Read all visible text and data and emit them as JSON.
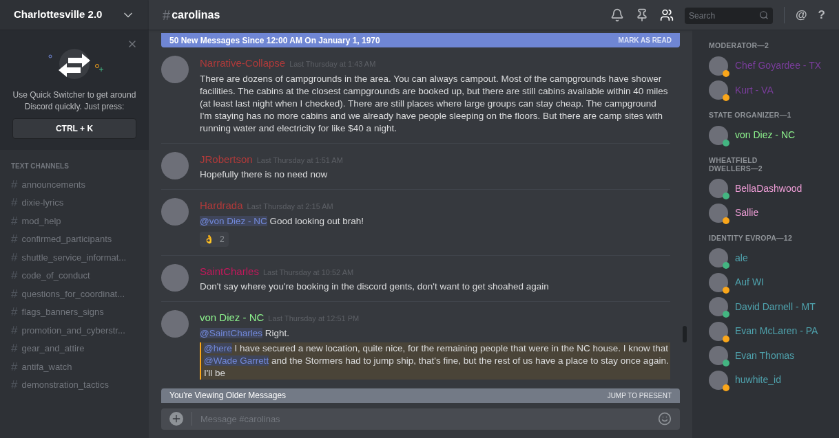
{
  "server": {
    "name": "Charlottesville 2.0"
  },
  "quick_switcher": {
    "text": "Use Quick Switcher to get around Discord quickly. Just press:",
    "shortcut": "CTRL + K"
  },
  "channel_section": {
    "label": "TEXT CHANNELS"
  },
  "channels": [
    {
      "name": "announcements"
    },
    {
      "name": "dixie-lyrics"
    },
    {
      "name": "mod_help"
    },
    {
      "name": "confirmed_participants"
    },
    {
      "name": "shuttle_service_informat..."
    },
    {
      "name": "code_of_conduct"
    },
    {
      "name": "questions_for_coordinat..."
    },
    {
      "name": "flags_banners_signs"
    },
    {
      "name": "promotion_and_cyberstr..."
    },
    {
      "name": "gear_and_attire"
    },
    {
      "name": "antifa_watch"
    },
    {
      "name": "demonstration_tactics"
    }
  ],
  "channel_header": {
    "hash": "#",
    "name": "carolinas"
  },
  "toolbar": {
    "search_placeholder": "Search",
    "glyphs": [
      "@",
      "?"
    ]
  },
  "new_messages_bar": {
    "text": "50 New Messages Since 12:00 AM On January 1, 1970",
    "action": "MARK AS READ"
  },
  "messages": [
    {
      "author": "Narrative-Collapse",
      "color": "#b03a3a",
      "time": "Last Thursday at 1:43 AM",
      "paragraphs": [
        {
          "quote": false,
          "parts": [
            {
              "kind": "text",
              "text": "There are dozens of campgrounds in the area. You can always campout. Most of the campgrounds have shower facilities. The cabins at the closest campgrounds are booked up, but there are still cabins available within 40 miles (at least last night when I checked). There are still places where large groups can stay cheap. The campground I'm staying has no more cabins and we already have people sleeping on the floors. But there are camp sites with running water and electricity for like $40 a night."
            }
          ]
        }
      ]
    },
    {
      "author": "JRobertson",
      "color": "#b03a3a",
      "time": "Last Thursday at 1:51 AM",
      "paragraphs": [
        {
          "quote": false,
          "parts": [
            {
              "kind": "text",
              "text": "Hopefully there is no need now"
            }
          ]
        }
      ]
    },
    {
      "author": "Hardrada",
      "color": "#b03a3a",
      "time": "Last Thursday at 2:15 AM",
      "paragraphs": [
        {
          "quote": false,
          "parts": [
            {
              "kind": "mention",
              "text": "@von Diez - NC"
            },
            {
              "kind": "text",
              "text": " Good looking out brah!"
            }
          ]
        }
      ],
      "reaction": {
        "emoji": "👌",
        "count": "2"
      }
    },
    {
      "author": "SaintCharles",
      "color": "#c2185b",
      "time": "Last Thursday at 10:52 AM",
      "paragraphs": [
        {
          "quote": false,
          "parts": [
            {
              "kind": "text",
              "text": "Don't say where you're booking in the discord gents, don't want to get shoahed again"
            }
          ]
        }
      ]
    },
    {
      "author": "von Diez - NC",
      "color": "#8ef58e",
      "time": "Last Thursday at 12:51 PM",
      "paragraphs": [
        {
          "quote": false,
          "parts": [
            {
              "kind": "mention",
              "text": "@SaintCharles"
            },
            {
              "kind": "text",
              "text": " Right."
            }
          ]
        },
        {
          "quote": true,
          "parts": [
            {
              "kind": "mention",
              "text": "@here"
            },
            {
              "kind": "text",
              "text": " I have secured a new location, quite nice, for the remaining people that were in the NC house. I know that "
            },
            {
              "kind": "mention",
              "text": "@Wade Garrett"
            },
            {
              "kind": "text",
              "text": " and the Stormers had to jump ship, that's fine, but the rest of us have a place to stay once again. I'll be"
            }
          ]
        }
      ]
    }
  ],
  "older_messages_bar": {
    "text": "You're Viewing Older Messages",
    "action": "JUMP TO PRESENT"
  },
  "composer": {
    "placeholder": "Message #carolinas"
  },
  "member_groups": [
    {
      "title": "MODERATOR—2",
      "members": [
        {
          "name": "Chef Goyardee - TX",
          "color": "#7a3d9c",
          "status": {
            "color": "#faa61a"
          }
        },
        {
          "name": "Kurt - VA",
          "color": "#7a3d9c",
          "status": {
            "color": "#faa61a"
          }
        }
      ]
    },
    {
      "title": "STATE ORGANIZER—1",
      "members": [
        {
          "name": "von Diez - NC",
          "color": "#8ef58e",
          "status": {
            "color": "#43b581"
          }
        }
      ]
    },
    {
      "title": "WHEATFIELD DWELLERS—2",
      "members": [
        {
          "name": "BellaDashwood",
          "color": "#f09ed8",
          "status": {
            "color": "#43b581"
          }
        },
        {
          "name": "Sallie",
          "color": "#f09ed8",
          "status": {
            "color": "#faa61a"
          }
        }
      ]
    },
    {
      "title": "IDENTITY EVROPA—12",
      "members": [
        {
          "name": "ale",
          "color": "#4fa3ae",
          "status": {
            "color": "#43b581"
          }
        },
        {
          "name": "Auf WI",
          "color": "#4fa3ae",
          "status": {
            "color": "#faa61a"
          }
        },
        {
          "name": "David Darnell - MT",
          "color": "#4fa3ae",
          "status": {
            "color": "#43b581"
          }
        },
        {
          "name": "Evan McLaren - PA",
          "color": "#4fa3ae",
          "status": {
            "color": "#faa61a"
          }
        },
        {
          "name": "Evan Thomas",
          "color": "#4fa3ae",
          "status": {
            "color": "#43b581"
          }
        },
        {
          "name": "huwhite_id",
          "color": "#4fa3ae",
          "status": {
            "color": "#faa61a"
          }
        }
      ]
    }
  ]
}
